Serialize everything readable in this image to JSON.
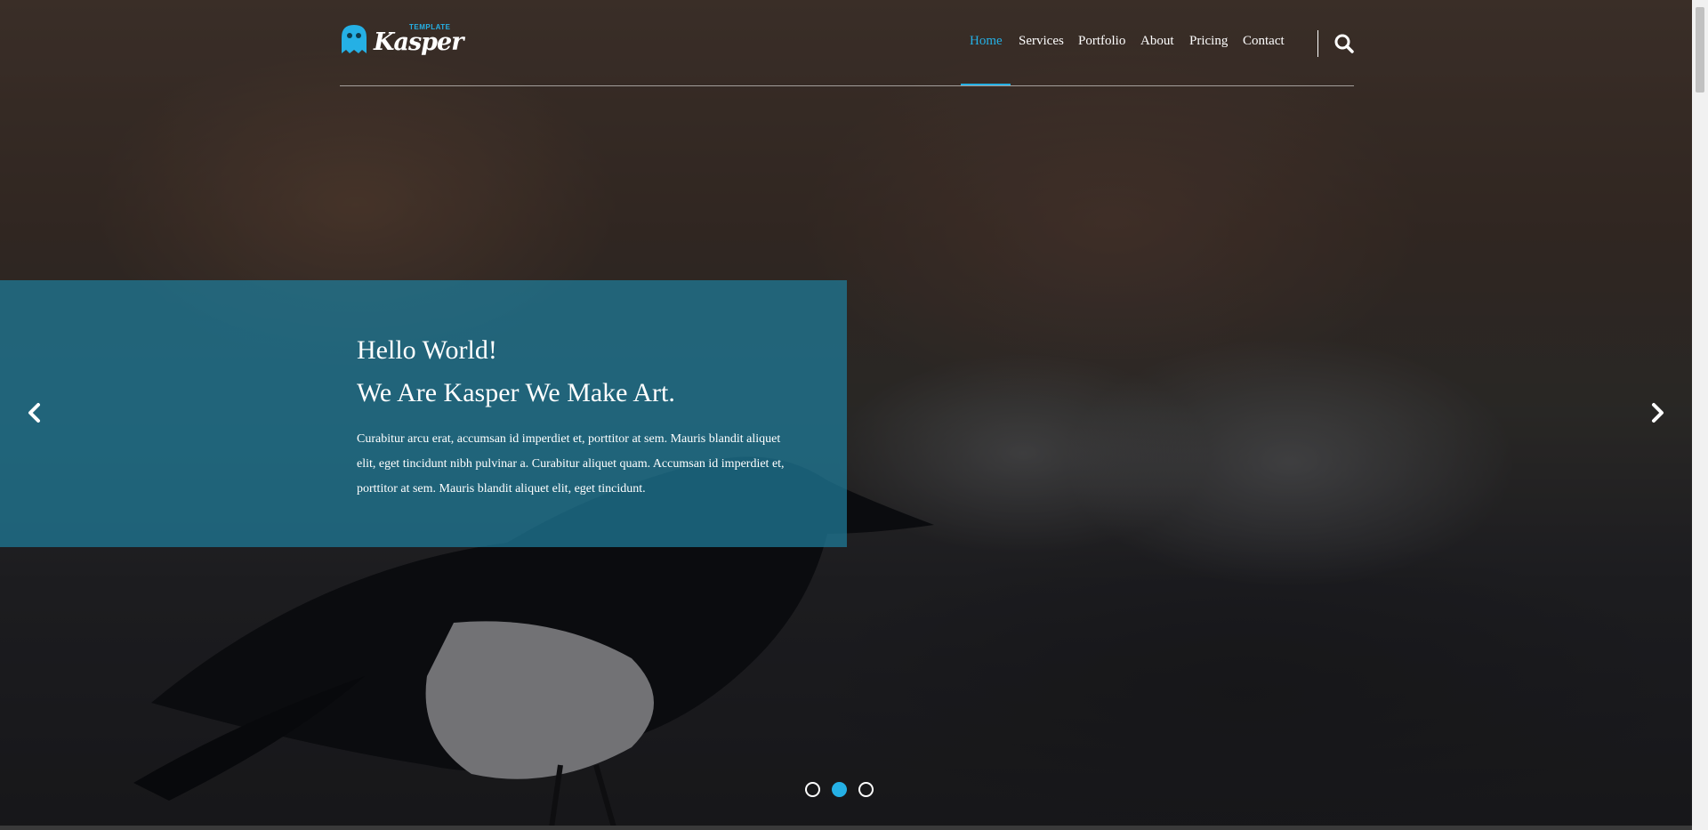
{
  "brand": {
    "name": "Kasper",
    "tagline": "TEMPLATE",
    "accent_color": "#25b0e5",
    "logo_icon": "ghost-icon"
  },
  "nav": {
    "items": [
      {
        "label": "Home",
        "active": true
      },
      {
        "label": "Services",
        "active": false
      },
      {
        "label": "Portfolio",
        "active": false
      },
      {
        "label": "About",
        "active": false
      },
      {
        "label": "Pricing",
        "active": false
      },
      {
        "label": "Contact",
        "active": false
      }
    ],
    "search_icon": "search-icon"
  },
  "slider": {
    "title_line1": "Hello World!",
    "title_line2": "We Are Kasper We Make Art.",
    "description": "Curabitur arcu erat, accumsan id imperdiet et, porttitor at sem. Mauris blandit aliquet elit, eget tincidunt nibh pulvinar a. Curabitur aliquet quam. Accumsan id imperdiet et, porttitor at sem. Mauris blandit aliquet elit, eget tincidunt.",
    "prev_icon": "chevron-left-icon",
    "next_icon": "chevron-right-icon",
    "slide_count": 3,
    "active_slide": 2,
    "box_color": "#1e7d9b"
  }
}
